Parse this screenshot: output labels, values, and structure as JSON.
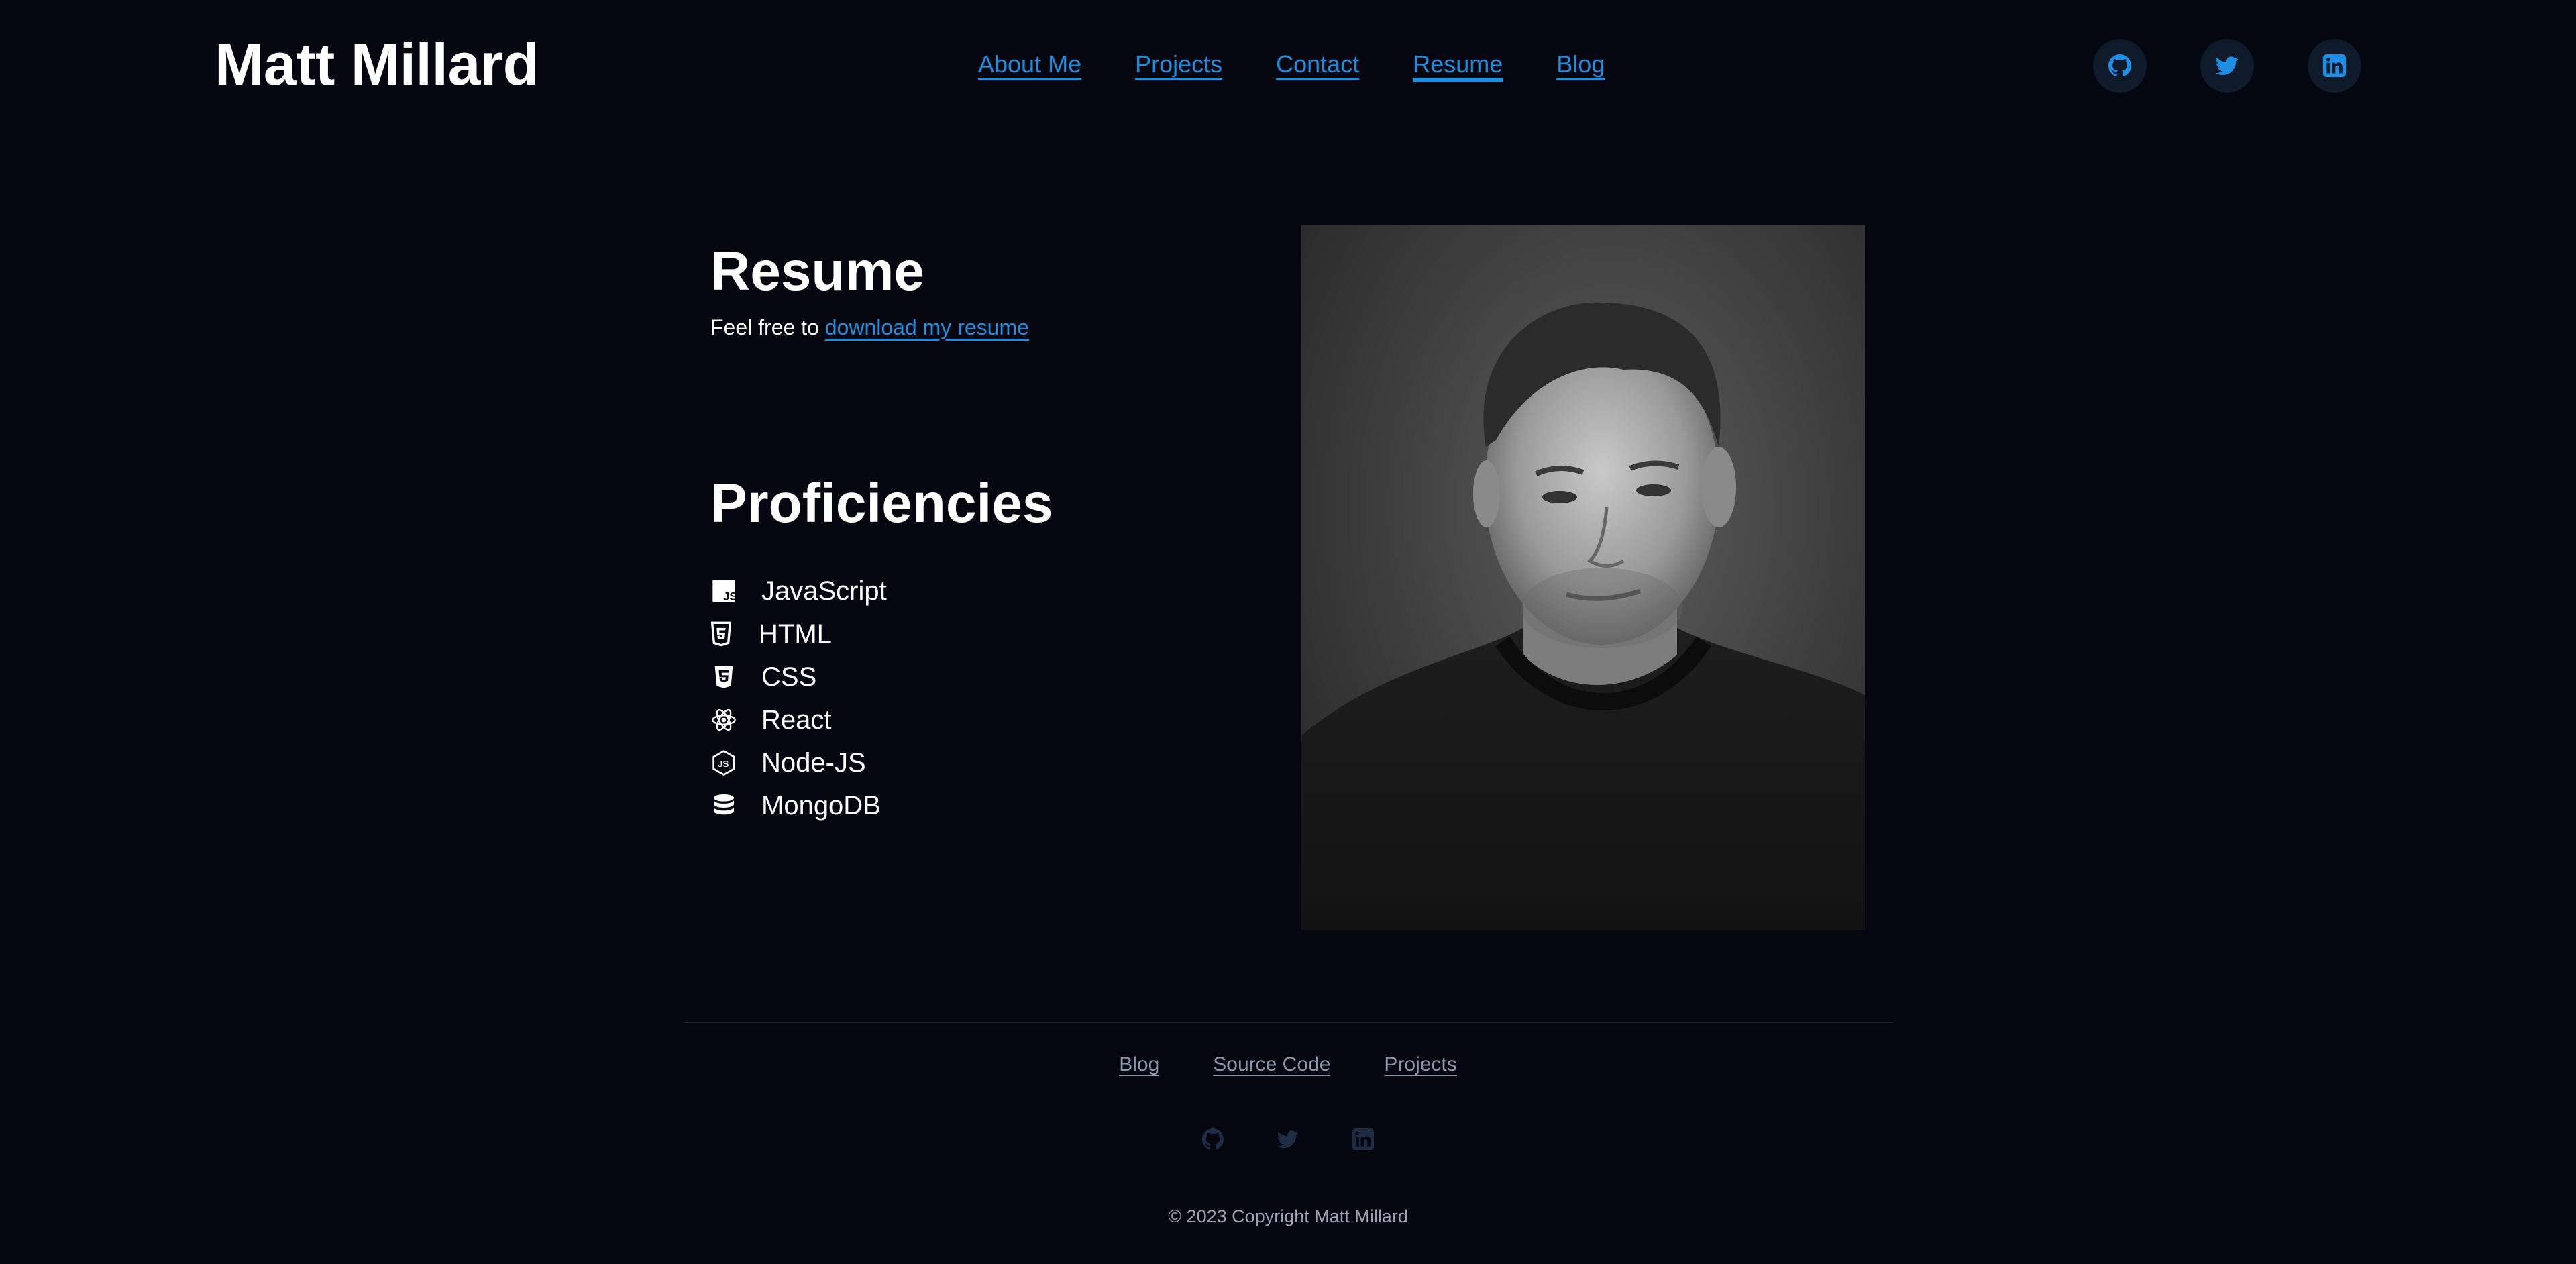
{
  "header": {
    "site_title": "Matt Millard",
    "nav": [
      {
        "label": "About Me",
        "active": false
      },
      {
        "label": "Projects",
        "active": false
      },
      {
        "label": "Contact",
        "active": false
      },
      {
        "label": "Resume",
        "active": true
      },
      {
        "label": "Blog",
        "active": false
      }
    ],
    "socials": [
      "github-icon",
      "twitter-icon",
      "linkedin-icon"
    ]
  },
  "resume": {
    "title": "Resume",
    "text_prefix": "Feel free to",
    "download_link": "download my resume"
  },
  "proficiencies": {
    "title": "Proficiencies",
    "items": [
      {
        "icon": "javascript-icon",
        "label": "JavaScript"
      },
      {
        "icon": "html5-icon",
        "label": "HTML"
      },
      {
        "icon": "css3-icon",
        "label": "CSS"
      },
      {
        "icon": "react-icon",
        "label": "React"
      },
      {
        "icon": "nodejs-icon",
        "label": "Node-JS"
      },
      {
        "icon": "database-icon",
        "label": "MongoDB"
      }
    ]
  },
  "footer": {
    "links": [
      "Blog",
      "Source Code",
      "Projects"
    ],
    "socials": [
      "github-icon",
      "twitter-icon",
      "linkedin-icon"
    ],
    "copyright": "© 2023 Copyright Matt Millard"
  },
  "colors": {
    "background": "#05060f",
    "accent": "#1e8fdf",
    "text": "#ffffff",
    "muted": "#8a98ad"
  }
}
